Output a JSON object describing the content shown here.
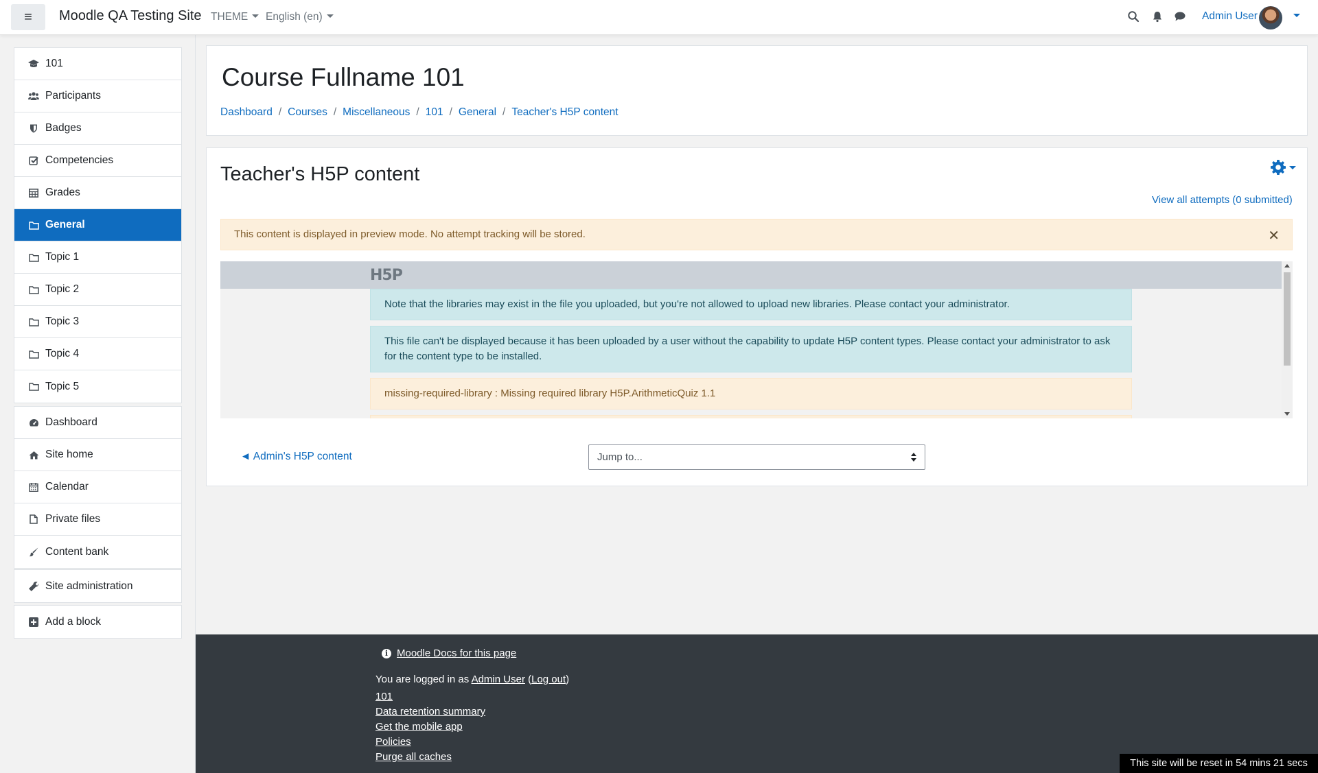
{
  "navbar": {
    "site_name": "Moodle QA Testing Site",
    "theme_label": "THEME",
    "language_label": "English (en)",
    "user_name": "Admin User"
  },
  "drawer": {
    "course_items": [
      {
        "label": "101",
        "icon": "graduation-cap-icon"
      },
      {
        "label": "Participants",
        "icon": "users-icon"
      },
      {
        "label": "Badges",
        "icon": "shield-icon"
      },
      {
        "label": "Competencies",
        "icon": "check-square-icon"
      },
      {
        "label": "Grades",
        "icon": "table-icon"
      },
      {
        "label": "General",
        "icon": "folder-icon",
        "active": true
      },
      {
        "label": "Topic 1",
        "icon": "folder-icon"
      },
      {
        "label": "Topic 2",
        "icon": "folder-icon"
      },
      {
        "label": "Topic 3",
        "icon": "folder-icon"
      },
      {
        "label": "Topic 4",
        "icon": "folder-icon"
      },
      {
        "label": "Topic 5",
        "icon": "folder-icon"
      }
    ],
    "site_items": [
      {
        "label": "Dashboard",
        "icon": "tachometer-icon"
      },
      {
        "label": "Site home",
        "icon": "home-icon"
      },
      {
        "label": "Calendar",
        "icon": "calendar-icon"
      },
      {
        "label": "Private files",
        "icon": "file-icon"
      },
      {
        "label": "Content bank",
        "icon": "paint-brush-icon"
      }
    ],
    "admin_item": {
      "label": "Site administration",
      "icon": "wrench-icon"
    },
    "add_block": {
      "label": "Add a block",
      "icon": "plus-square-icon"
    }
  },
  "header": {
    "course_title": "Course Fullname 101",
    "breadcrumb": [
      "Dashboard",
      "Courses",
      "Miscellaneous",
      "101",
      "General",
      "Teacher's H5P content"
    ]
  },
  "activity": {
    "title": "Teacher's H5P content",
    "view_attempts": "View all attempts (0 submitted)",
    "preview_notice": "This content is displayed in preview mode. No attempt tracking will be stored.",
    "h5p_logo": "H5P",
    "messages": [
      {
        "type": "info",
        "text": "Note that the libraries may exist in the file you uploaded, but you're not allowed to upload new libraries. Please contact your administrator."
      },
      {
        "type": "info",
        "text": "This file can't be displayed because it has been uploaded by a user without the capability to update H5P content types. Please contact your administrator to ask for the content type to be installed."
      },
      {
        "type": "warning",
        "text": "missing-required-library : Missing required library H5P.ArithmeticQuiz 1.1"
      }
    ],
    "prev_link": "Admin's H5P content",
    "jump_to": "Jump to..."
  },
  "footer": {
    "docs_link": "Moodle Docs for this page",
    "logged_in_prefix": "You are logged in as",
    "logged_in_user": "Admin User",
    "logout": "Log out",
    "links": [
      "101",
      "Data retention summary",
      "Get the mobile app",
      "Policies",
      "Purge all caches"
    ],
    "reset_notice": "This site will be reset in 54 mins 21 secs"
  },
  "colors": {
    "accent": "#0f6cbf",
    "footer_bg": "#343a40",
    "info_bg": "#cde8eb",
    "warning_bg": "#fcefdc"
  }
}
